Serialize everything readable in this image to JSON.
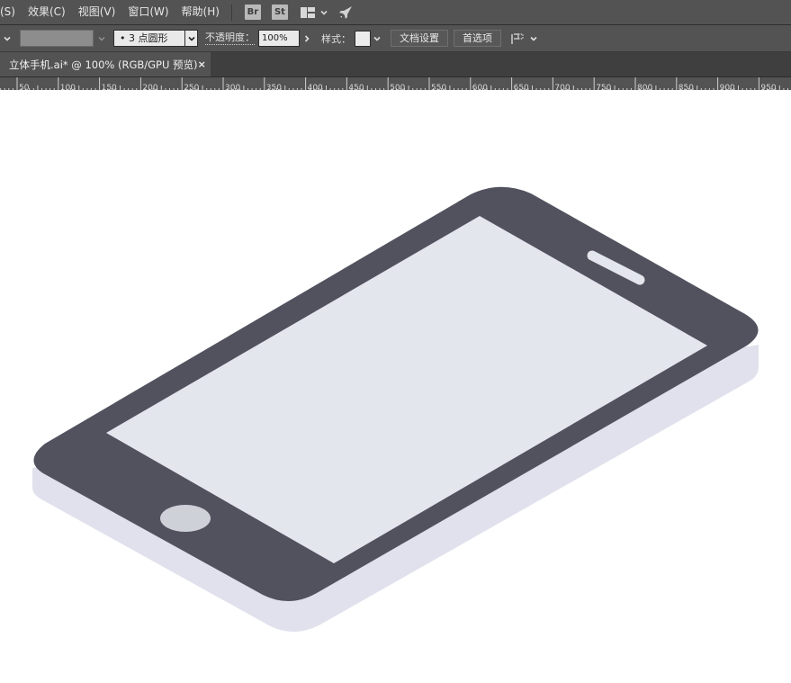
{
  "menubar": {
    "items": [
      {
        "label": "(S)"
      },
      {
        "label": "效果(C)"
      },
      {
        "label": "视图(V)"
      },
      {
        "label": "窗口(W)"
      },
      {
        "label": "帮助(H)"
      }
    ],
    "bridge_label": "Br",
    "stock_label": "St"
  },
  "controlbar": {
    "brush_value": "•  3  点圆形",
    "opacity_label": "不透明度：",
    "opacity_value": "100%",
    "style_label": "样式：",
    "doc_setup_label": "文档设置",
    "preferences_label": "首选项",
    "stroke_color": "#8d8d8d",
    "style_swatch_color": "#ececec"
  },
  "tab": {
    "title": "立体手机.ai* @ 100% (RGB/GPU 预览)",
    "close_glyph": "×"
  },
  "ruler": {
    "labels": [
      "50",
      "100",
      "150",
      "200",
      "250",
      "300",
      "350",
      "400",
      "450",
      "500",
      "550",
      "600",
      "650",
      "700",
      "750",
      "800",
      "850",
      "900",
      "950"
    ]
  },
  "artwork": {
    "body_color": "#52525f",
    "base_color": "#e1e1ed",
    "screen_color": "#e4e6ee",
    "speaker_color": "#e4e6ee",
    "home_button_color": "#cfd1d9"
  }
}
